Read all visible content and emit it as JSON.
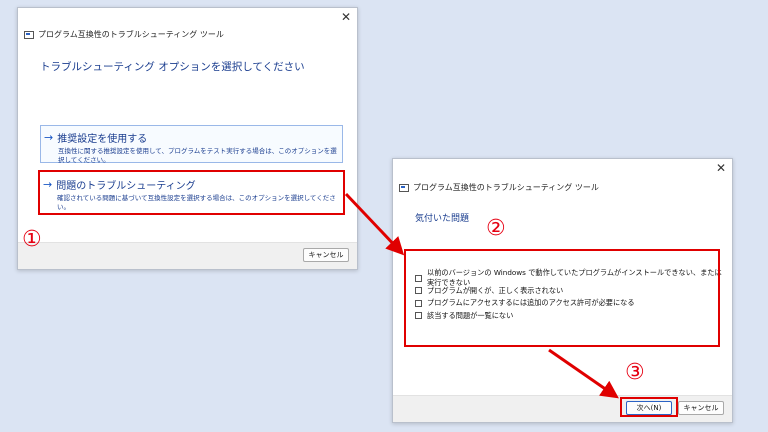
{
  "dialog1": {
    "title": "プログラム互換性のトラブルシューティング ツール",
    "heading": "トラブルシューティング オプションを選択してください",
    "options": [
      {
        "title": "推奨設定を使用する",
        "description": "互換性に関する推奨設定を使用して、プログラムをテスト実行する場合は、このオプションを選択してください。"
      },
      {
        "title": "問題のトラブルシューティング",
        "description": "確認されている問題に基づいて互換性設定を選択する場合は、このオプションを選択してください。"
      }
    ],
    "cancel_label": "キャンセル"
  },
  "dialog2": {
    "title": "プログラム互換性のトラブルシューティング ツール",
    "heading": "気付いた問題",
    "problems": [
      "以前のバージョンの Windows で動作していたプログラムがインストールできない、または実行できない",
      "プログラムが開くが、正しく表示されない",
      "プログラムにアクセスするには追加のアクセス許可が必要になる",
      "該当する問題が一覧にない"
    ],
    "next_label": "次へ(N)",
    "cancel_label": "キャンセル"
  },
  "annotations": {
    "step1": "①",
    "step2": "②",
    "step3": "③",
    "color": "#e00000"
  },
  "icons": {
    "close": "close-icon",
    "arrow": "arrow-right-icon",
    "app": "app-icon"
  }
}
